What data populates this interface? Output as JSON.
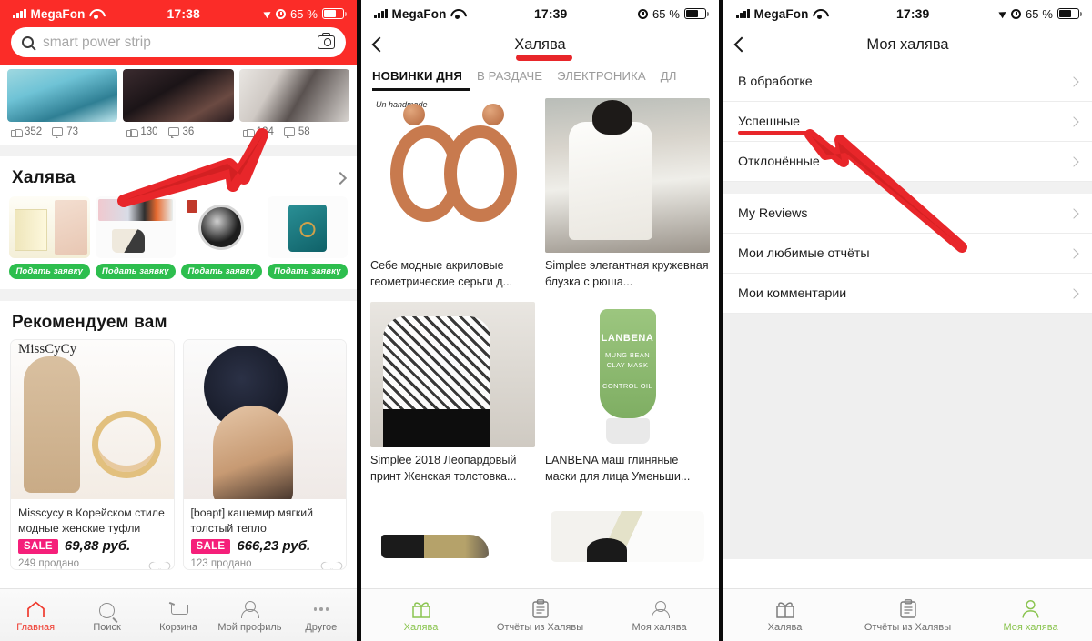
{
  "panel1": {
    "status": {
      "carrier": "MegaFon",
      "time": "17:38",
      "battery": "65 %"
    },
    "search": {
      "placeholder": "smart power strip",
      "search_icon": "search-icon",
      "camera_icon": "camera-icon"
    },
    "feed": [
      {
        "likes": "352",
        "comments": "73"
      },
      {
        "likes": "130",
        "comments": "36"
      },
      {
        "likes": "124",
        "comments": "58"
      }
    ],
    "halyava": {
      "title": "Халява",
      "chevron": "chevron-right-icon",
      "items": [
        {
          "button": "Подать заявку"
        },
        {
          "button": "Подать заявку"
        },
        {
          "button": "Подать заявку"
        },
        {
          "button": "Подать заявку"
        }
      ]
    },
    "recommend": {
      "title": "Рекомендуем вам",
      "cards": [
        {
          "title": "Misscycy в Корейском стиле модные женские туфли Jewel...",
          "tag": "SALE",
          "price": "69,88 руб.",
          "sold": "249 продано"
        },
        {
          "title": "[boapt] кашемир мягкий толстый тепло Двухъярусны...",
          "tag": "SALE",
          "price": "666,23 руб.",
          "sold": "123 продано"
        }
      ]
    },
    "tabbar": [
      {
        "label": "Главная",
        "icon": "home-icon",
        "active": true
      },
      {
        "label": "Поиск",
        "icon": "search-icon",
        "active": false
      },
      {
        "label": "Корзина",
        "icon": "cart-icon",
        "active": false
      },
      {
        "label": "Мой профиль",
        "icon": "person-icon",
        "active": false
      },
      {
        "label": "Другое",
        "icon": "ellipsis-icon",
        "active": false
      }
    ]
  },
  "panel2": {
    "status": {
      "carrier": "MegaFon",
      "time": "17:39",
      "battery": "65 %"
    },
    "nav": {
      "back_icon": "back-chevron-icon",
      "title": "Халява"
    },
    "tabs": [
      {
        "label": "НОВИНКИ ДНЯ",
        "selected": true
      },
      {
        "label": "В РАЗДАЧЕ",
        "selected": false
      },
      {
        "label": "ЭЛЕКТРОНИКА",
        "selected": false
      },
      {
        "label": "ДЛ",
        "selected": false
      }
    ],
    "products": [
      {
        "title": "Себе модные акриловые геометрические серьги д..."
      },
      {
        "title": "Simplee элегантная кружевная блузка с рюша..."
      },
      {
        "title": "Simplee 2018 Леопардовый принт Женская толстовка..."
      },
      {
        "title": "LANBENA маш глиняные маски для лица Уменьши..."
      }
    ],
    "product_labels": {
      "lanbena_brand": "LANBENA",
      "lanbena_line1": "MUNG BEAN",
      "lanbena_line2": "CLAY MASK",
      "lanbena_line3": "CONTROL OIL"
    },
    "tabbar": [
      {
        "label": "Халява",
        "icon": "gift-icon",
        "active": true
      },
      {
        "label": "Отчёты из Халявы",
        "icon": "clipboard-icon",
        "active": false
      },
      {
        "label": "Моя халява",
        "icon": "person-icon",
        "active": false
      }
    ]
  },
  "panel3": {
    "status": {
      "carrier": "MegaFon",
      "time": "17:39",
      "battery": "65 %"
    },
    "nav": {
      "back_icon": "back-chevron-icon",
      "title": "Моя халява"
    },
    "group1": [
      {
        "label": "В обработке",
        "chevron": "chevron-right-icon"
      },
      {
        "label": "Успешные",
        "chevron": "chevron-right-icon",
        "highlighted": true
      },
      {
        "label": "Отклонённые",
        "chevron": "chevron-right-icon"
      }
    ],
    "group2": [
      {
        "label": "My Reviews",
        "chevron": "chevron-right-icon"
      },
      {
        "label": "Мои любимые отчёты",
        "chevron": "chevron-right-icon"
      },
      {
        "label": "Мои комментарии",
        "chevron": "chevron-right-icon"
      }
    ],
    "tabbar": [
      {
        "label": "Халява",
        "icon": "gift-icon",
        "active": false
      },
      {
        "label": "Отчёты из Халявы",
        "icon": "clipboard-icon",
        "active": false
      },
      {
        "label": "Моя халява",
        "icon": "person-icon",
        "active": true
      }
    ]
  },
  "colors": {
    "brand_red": "#fb2c28",
    "annotation_red": "#e8262a",
    "sale_pink": "#f51f7a",
    "apply_green": "#2dbe4e",
    "tab_green": "#8ac44f"
  }
}
